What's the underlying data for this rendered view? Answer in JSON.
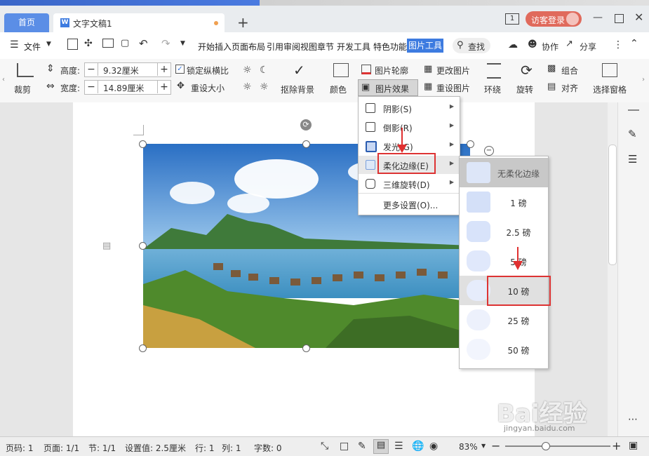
{
  "tabs": {
    "home": "首页",
    "document": "文字文稿1",
    "new_tab": "+"
  },
  "title_right": {
    "page_icon": "1",
    "guest_login": "访客登录"
  },
  "menu": {
    "file": "文件",
    "items": [
      "开始",
      "插入",
      "页面布局",
      "引用",
      "审阅",
      "视图",
      "章节",
      "开发工具",
      "特色功能"
    ],
    "active": "图片工具",
    "search": "查找",
    "collab": "协作",
    "share": "分享"
  },
  "ribbon": {
    "crop": "裁剪",
    "height_label": "高度:",
    "height_value": "9.32厘米",
    "width_label": "宽度:",
    "width_value": "14.89厘米",
    "lock_ratio": "锁定纵横比",
    "reset_size": "重设大小",
    "remove_bg": "抠除背景",
    "color": "颜色",
    "picture_outline": "图片轮廓",
    "picture_effects": "图片效果",
    "change_picture": "更改图片",
    "reset_picture": "重设图片",
    "wrap": "环绕",
    "rotate": "旋转",
    "group": "组合",
    "align": "对齐",
    "selection_pane": "选择窗格"
  },
  "effects_menu": {
    "items": [
      "阴影(S)",
      "倒影(R)",
      "发光(G)",
      "柔化边缘(E)",
      "三维旋转(D)"
    ],
    "more": "更多设置(O)..."
  },
  "soft_edge_menu": {
    "items": [
      "无柔化边缘",
      "1 磅",
      "2.5 磅",
      "5 磅",
      "10 磅",
      "25 磅",
      "50 磅"
    ]
  },
  "watermark": {
    "main": "Bai经验",
    "sub": "jingyan.baidu.com"
  },
  "status": {
    "page": "页码: 1",
    "pages": "页面: 1/1",
    "section": "节: 1/1",
    "setting": "设置值: 2.5厘米",
    "row": "行: 1",
    "col": "列: 1",
    "words": "字数: 0",
    "zoom": "83%"
  },
  "colors": {
    "accent": "#3d7be0",
    "highlight": "#dd3333"
  }
}
